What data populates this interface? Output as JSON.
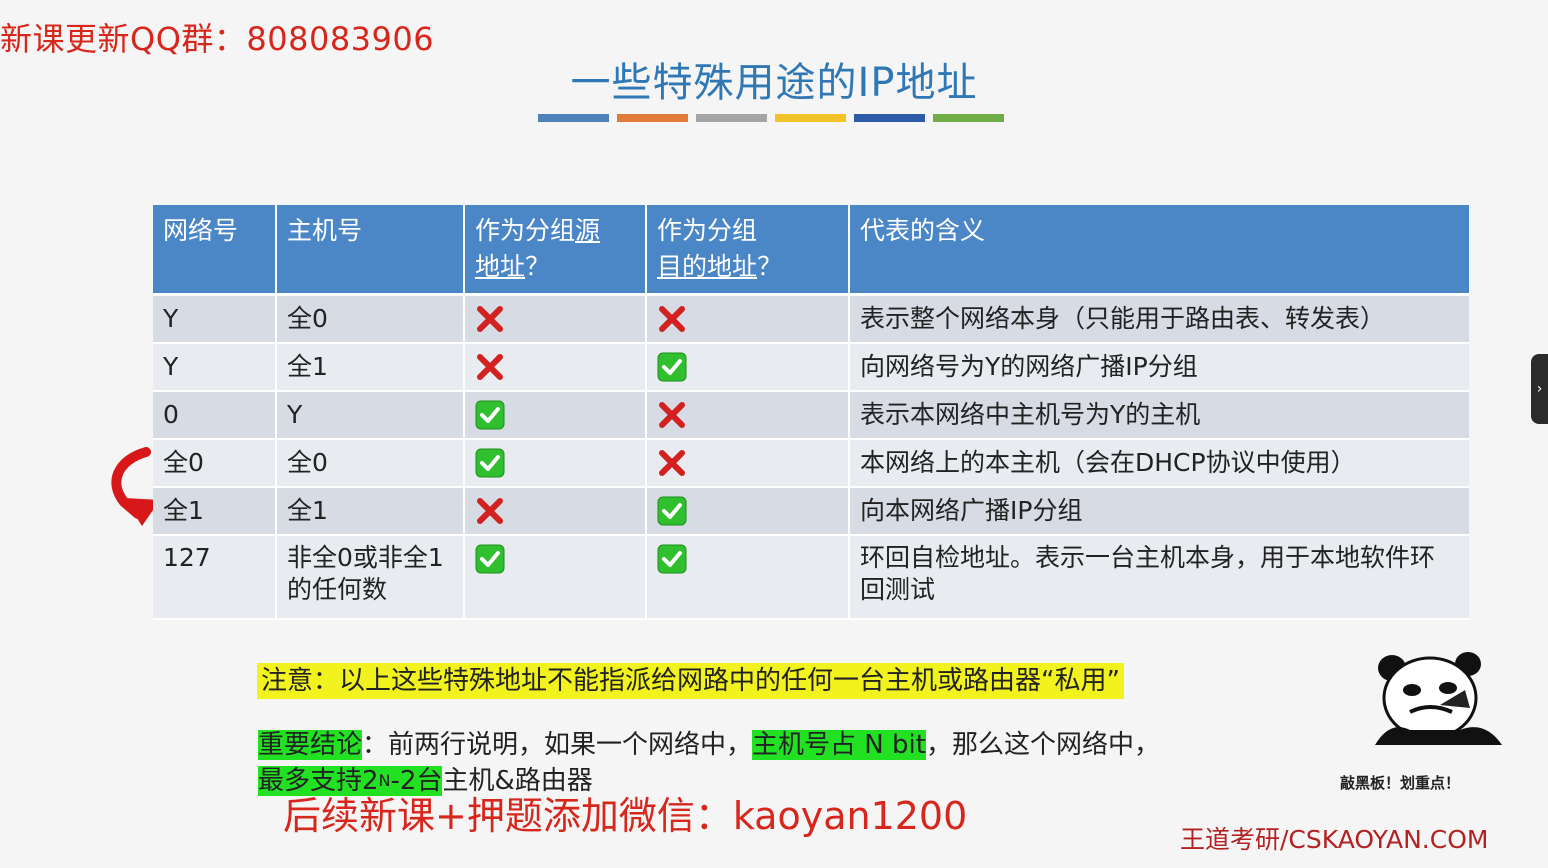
{
  "banner": {
    "qq_text": "新课更新QQ群：808083906"
  },
  "slide": {
    "title": "一些特殊用途的IP地址",
    "color_bars": [
      "#4f81bd",
      "#e07b39",
      "#a5a5a5",
      "#f2c229",
      "#2e5aa8",
      "#70ad47"
    ]
  },
  "table": {
    "headers": {
      "network": "网络号",
      "host": "主机号",
      "as_source_a": "作为分组",
      "as_source_b": "源",
      "as_source_c": "地址",
      "as_source_q": "？",
      "as_dest_a": "作为分组",
      "as_dest_b": "目的地址",
      "as_dest_q": "？",
      "meaning": "代表的含义"
    },
    "rows": [
      {
        "network": "Y",
        "host": "全0",
        "source": "no",
        "dest": "no",
        "meaning": "表示整个网络本身（只能用于路由表、转发表）"
      },
      {
        "network": "Y",
        "host": "全1",
        "source": "no",
        "dest": "yes",
        "meaning": "向网络号为Y的网络广播IP分组"
      },
      {
        "network": "0",
        "host": "Y",
        "source": "yes",
        "dest": "no",
        "meaning": "表示本网络中主机号为Y的主机"
      },
      {
        "network": "全0",
        "host": "全0",
        "source": "yes",
        "dest": "no",
        "meaning": "本网络上的本主机（会在DHCP协议中使用）"
      },
      {
        "network": "全1",
        "host": "全1",
        "source": "no",
        "dest": "yes",
        "meaning": "向本网络广播IP分组"
      },
      {
        "network": "127",
        "host": "非全0或非全1的任何数",
        "source": "yes",
        "dest": "yes",
        "meaning": "环回自检地址。表示一台主机本身，用于本地软件环回测试"
      }
    ]
  },
  "notice": {
    "text": "注意：以上这些特殊地址不能指派给网路中的任何一台主机或路由器“私用”"
  },
  "conclusion": {
    "label": "重要结论",
    "text1": "：前两行说明，如果一个网络中，",
    "highlight": "主机号占 N bit",
    "text2": "，那么这个网络中，",
    "line2_hl_a": "最多支持2",
    "line2_sup": "N",
    "line2_hl_b": "-2台",
    "line2_rest": "主机&路由器"
  },
  "overlay": {
    "wechat": "后续新课+押题添加微信：kaoyan1200"
  },
  "brand": {
    "text": "王道考研/CSKAOYAN.COM"
  },
  "meme": {
    "caption": "敲黑板！划重点！"
  },
  "side_tab": {
    "icon": "chevron-right-icon",
    "glyph": "›"
  },
  "colors": {
    "header": "#4b86c6",
    "cross": "#d32020",
    "check": "#2fbf2f",
    "red_text": "#d7261b"
  }
}
